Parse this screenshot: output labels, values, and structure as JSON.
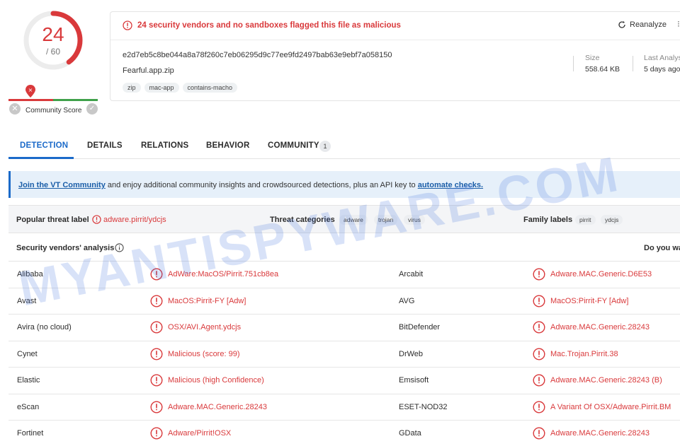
{
  "score": {
    "detections": "24",
    "total": "/ 60",
    "community_label": "Community Score"
  },
  "file": {
    "flag_text": "24 security vendors and no sandboxes flagged this file as malicious",
    "reanalyze_label": "Reanalyze",
    "hash": "e2d7eb5c8be044a8a78f260c7eb06295d9c77ee9fd2497bab63e9ebf7a058150",
    "name": "Fearful.app.zip",
    "tags": [
      "zip",
      "mac-app",
      "contains-macho"
    ],
    "size_label": "Size",
    "size_value": "558.64 KB",
    "last_label": "Last Analys",
    "last_value": "5 days ago"
  },
  "tabs": [
    {
      "label": "DETECTION"
    },
    {
      "label": "DETAILS"
    },
    {
      "label": "RELATIONS"
    },
    {
      "label": "BEHAVIOR"
    },
    {
      "label": "COMMUNITY"
    }
  ],
  "community_count": "1",
  "banner": {
    "link1": "Join the VT Community",
    "middle": " and enjoy additional community insights and crowdsourced detections, plus an API key to ",
    "link2": "automate checks."
  },
  "threat": {
    "popular_label": "Popular threat label",
    "popular_value": "adware.pirrit/ydcjs",
    "categories_label": "Threat categories",
    "categories": [
      "adware",
      "trojan",
      "virus"
    ],
    "family_label": "Family labels",
    "families": [
      "pirrit",
      "ydcjs"
    ]
  },
  "vendors_title": "Security vendors' analysis",
  "vendors_right": "Do you wa",
  "vendors": [
    {
      "left_name": "Alibaba",
      "left_result": "AdWare:MacOS/Pirrit.751cb8ea",
      "right_name": "Arcabit",
      "right_result": "Adware.MAC.Generic.D6E53"
    },
    {
      "left_name": "Avast",
      "left_result": "MacOS:Pirrit-FY [Adw]",
      "right_name": "AVG",
      "right_result": "MacOS:Pirrit-FY [Adw]"
    },
    {
      "left_name": "Avira (no cloud)",
      "left_result": "OSX/AVI.Agent.ydcjs",
      "right_name": "BitDefender",
      "right_result": "Adware.MAC.Generic.28243"
    },
    {
      "left_name": "Cynet",
      "left_result": "Malicious (score: 99)",
      "right_name": "DrWeb",
      "right_result": "Mac.Trojan.Pirrit.38"
    },
    {
      "left_name": "Elastic",
      "left_result": "Malicious (high Confidence)",
      "right_name": "Emsisoft",
      "right_result": "Adware.MAC.Generic.28243 (B)"
    },
    {
      "left_name": "eScan",
      "left_result": "Adware.MAC.Generic.28243",
      "right_name": "ESET-NOD32",
      "right_result": "A Variant Of OSX/Adware.Pirrit.BM"
    },
    {
      "left_name": "Fortinet",
      "left_result": "Adware/Pirrit!OSX",
      "right_name": "GData",
      "right_result": "Adware.MAC.Generic.28243"
    }
  ],
  "watermark": "MYANTISPYWARE.COM",
  "colors": {
    "malicious": "#d9393b",
    "accent": "#1b6ac9",
    "clean": "#3fa14b"
  }
}
